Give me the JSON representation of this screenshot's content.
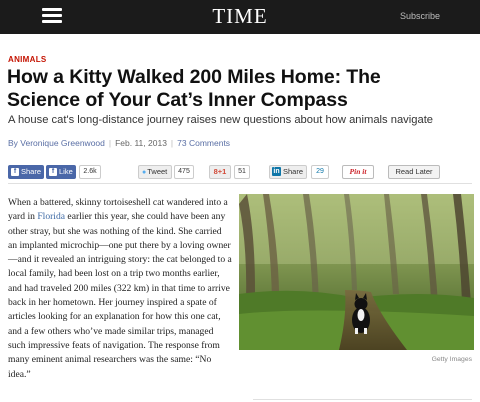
{
  "header": {
    "logo": "TIME",
    "subscribe_label": "Subscribe",
    "menu_icon": "hamburger-menu-icon"
  },
  "article": {
    "section": "ANIMALS",
    "headline_line1": "How a Kitty Walked 200 Miles Home: The",
    "headline_line2": "Science of Your Cat’s Inner Compass",
    "dek": "A house cat's long-distance journey raises new questions about how animals navigate",
    "byline": {
      "author": "By Veronique Greenwood",
      "date": "Feb. 11, 2013",
      "comments": "73 Comments"
    }
  },
  "share": {
    "facebook_share": "Share",
    "facebook_like": "Like",
    "like_count": "2.6k",
    "tweet": "Tweet",
    "tweet_count": "475",
    "gplus": "8+1",
    "gplus_count": "51",
    "linkedin": "Share",
    "linkedin_count": "29",
    "pinit": "Pin it",
    "read_later": "Read Later"
  },
  "body": {
    "p1_a": "When a battered, skinny tortoiseshell cat wandered into a yard in ",
    "p1_link": "Florida",
    "p1_b": " earlier this year, she could have been any other stray, but she was nothing of the kind. She carried an implanted microchip—one put there by a loving owner—and it revealed an intriguing story: the cat belonged to a local family, had been lost on a trip two months earlier, and  had traveled 200 miles (322 km) in that time to arrive back in her hometown. Her journey inspired a spate of articles looking for an explanation for how this one cat, and a few others who’ve made similar trips, managed such impressive feats of navigation. The response from many eminent animal researchers was the same: “No idea.”"
  },
  "photo": {
    "credit": "Getty Images",
    "alt": "cat"
  },
  "colors": {
    "topbar": "#1b1b1b",
    "section_red": "#c41200",
    "facebook_blue": "#4a67a8",
    "link_blue": "#3e6aa5"
  }
}
